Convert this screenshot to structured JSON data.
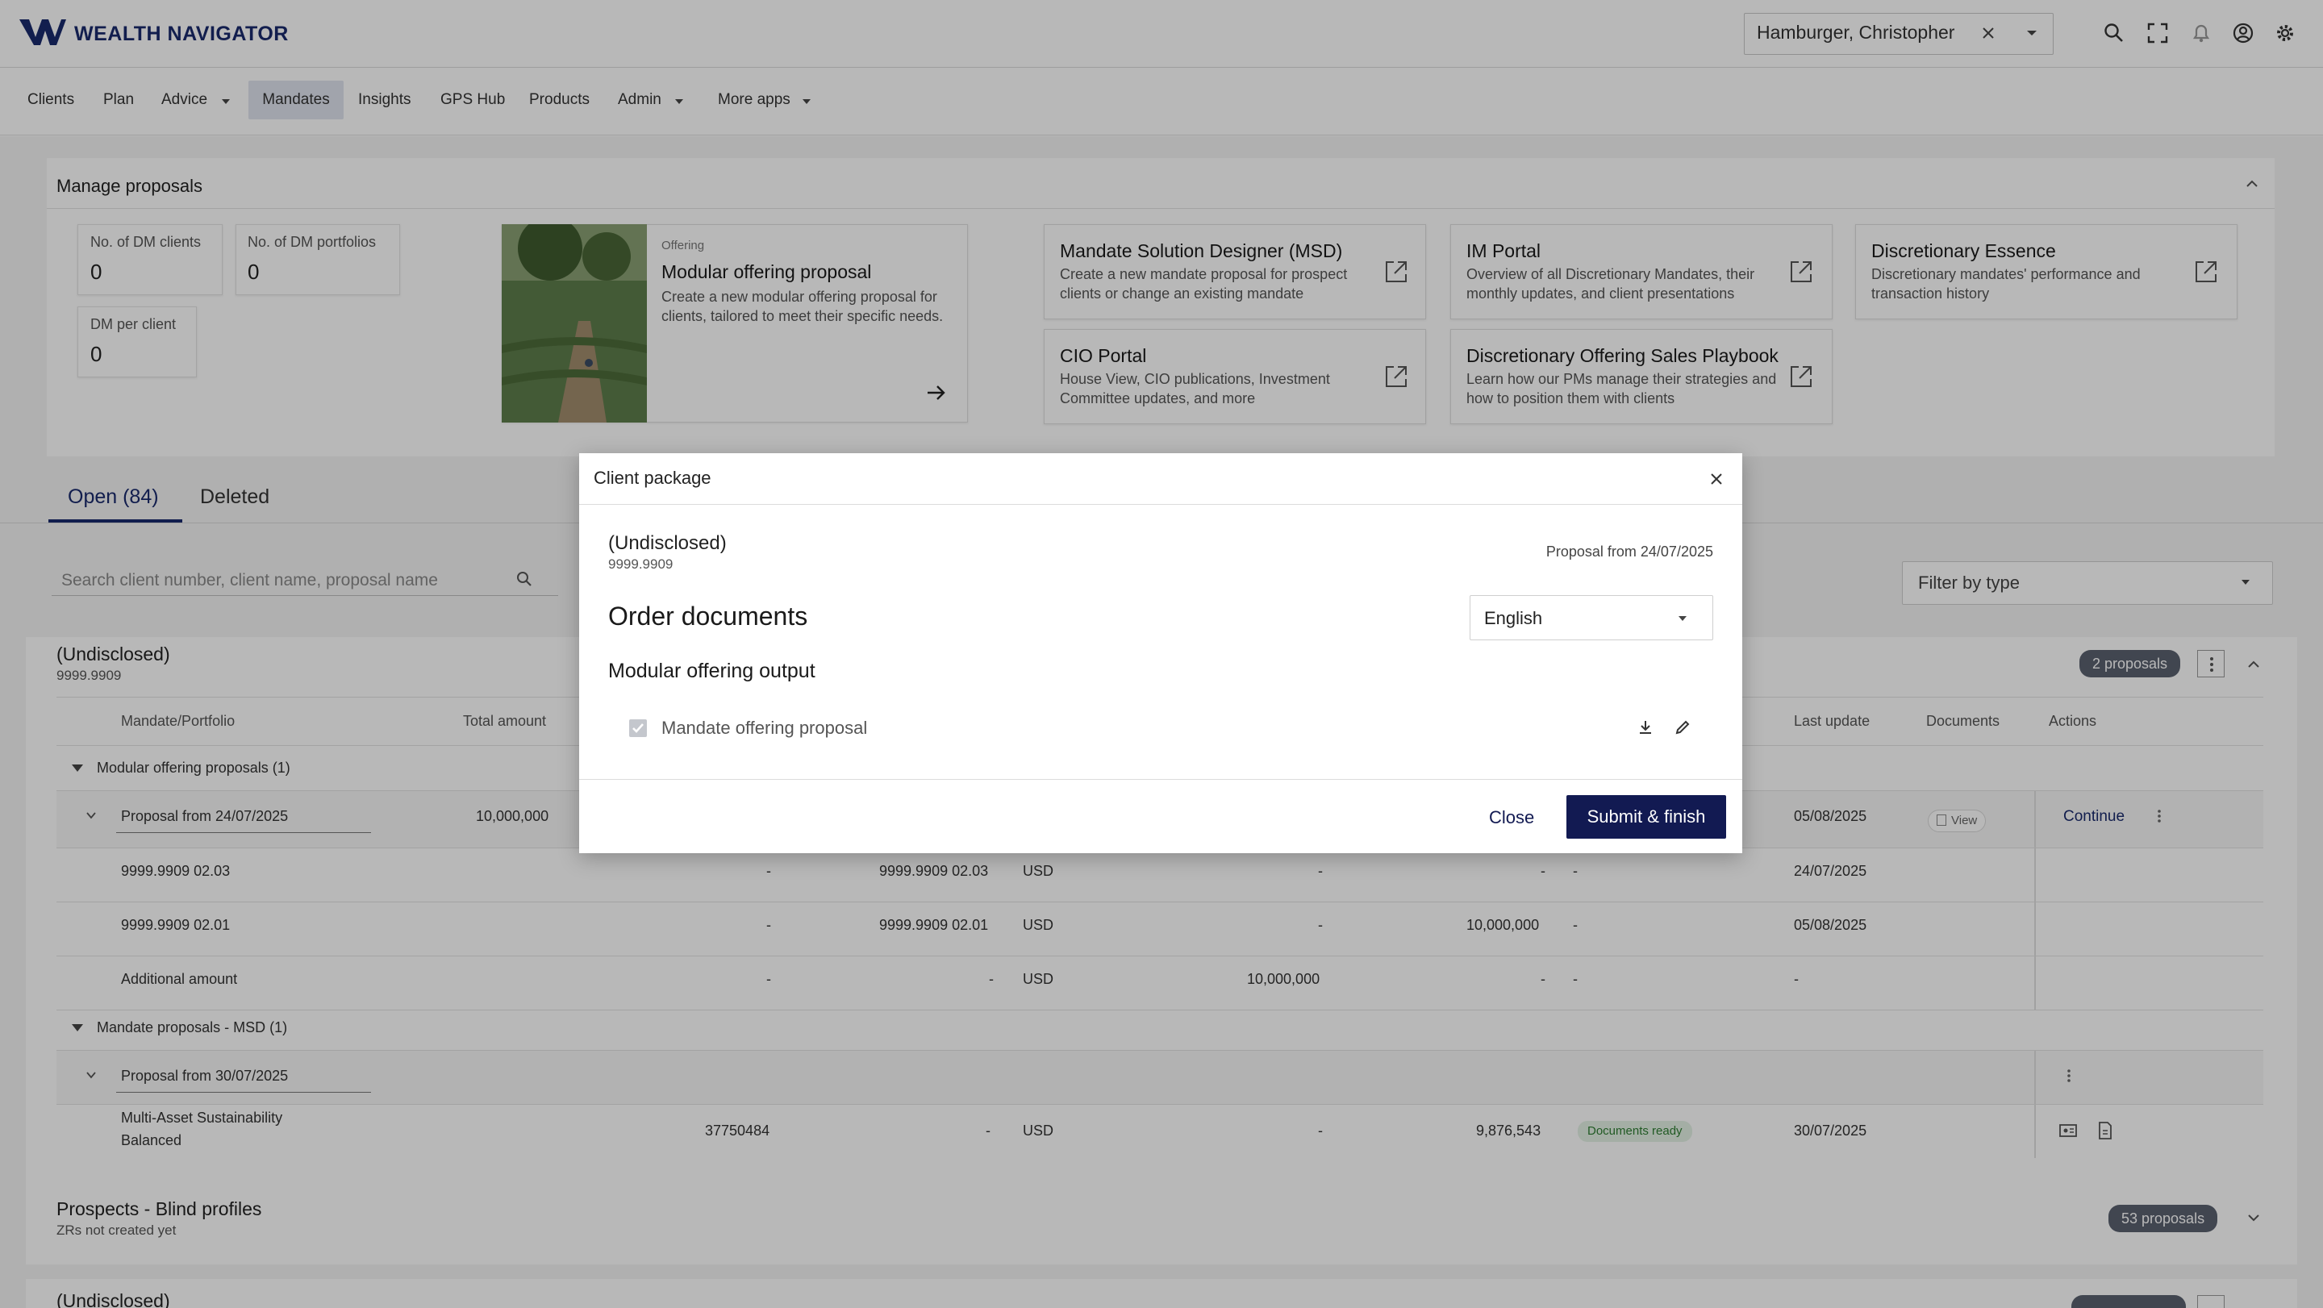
{
  "app": {
    "brand": "WEALTH NAVIGATOR"
  },
  "header": {
    "client_name": "Hamburger, Christopher",
    "icons": [
      "search-icon",
      "fullscreen-icon",
      "bell-icon",
      "user-icon",
      "gear-icon"
    ]
  },
  "nav": {
    "items": [
      {
        "label": "Clients"
      },
      {
        "label": "Plan"
      },
      {
        "label": "Advice"
      },
      {
        "label": "Mandates"
      },
      {
        "label": "Insights"
      },
      {
        "label": "GPS Hub"
      },
      {
        "label": "Products"
      },
      {
        "label": "Admin"
      },
      {
        "label": "More apps"
      }
    ],
    "active": "Mandates"
  },
  "manage": {
    "title": "Manage proposals",
    "kpis": [
      {
        "label": "No. of DM clients",
        "value": "0"
      },
      {
        "label": "No. of DM portfolios",
        "value": "0"
      },
      {
        "label": "DM per client",
        "value": "0"
      }
    ],
    "offering": {
      "eyebrow": "Offering",
      "title": "Modular offering proposal",
      "desc": "Create a new modular offering proposal for clients, tailored to meet their specific needs."
    },
    "tiles": [
      {
        "title": "Mandate Solution Designer (MSD)",
        "desc": "Create a new mandate proposal for prospect clients or change an existing mandate"
      },
      {
        "title": "IM Portal",
        "desc": "Overview of all Discretionary Mandates, their monthly updates, and client presentations"
      },
      {
        "title": "Discretionary Essence",
        "desc": "Discretionary mandates' performance and transaction history"
      },
      {
        "title": "CIO Portal",
        "desc": "House View, CIO publications, Investment Committee updates, and more"
      },
      {
        "title": "Discretionary Offering Sales Playbook",
        "desc": "Learn how our PMs manage their strategies and how to position them with clients"
      }
    ]
  },
  "tabs": {
    "open": "Open (84)",
    "deleted": "Deleted"
  },
  "filters": {
    "search_placeholder": "Search client number, client name, proposal name",
    "filter_type": "Filter by type"
  },
  "group1": {
    "name": "(Undisclosed)",
    "number": "9999.9909",
    "count": "2 proposals",
    "headers": {
      "mandate": "Mandate/Portfolio",
      "total": "Total amount",
      "last_update": "Last update",
      "documents": "Documents",
      "actions": "Actions"
    },
    "sub1": "Modular offering proposals (1)",
    "proposal1": {
      "name": "Proposal from 24/07/2025",
      "total": "10,000,000",
      "last_update": "05/08/2025",
      "doc": "View",
      "action": "Continue"
    },
    "rows": [
      {
        "name": "9999.9909 02.03",
        "c1": "-",
        "c2": "9999.9909 02.03",
        "cur": "USD",
        "c3": "-",
        "c4": "-",
        "c5": "-",
        "last": "24/07/2025"
      },
      {
        "name": "9999.9909 02.01",
        "c1": "-",
        "c2": "9999.9909 02.01",
        "cur": "USD",
        "c3": "-",
        "c4": "10,000,000",
        "c5": "-",
        "last": "05/08/2025"
      },
      {
        "name": "Additional amount",
        "c1": "-",
        "c2": "-",
        "cur": "USD",
        "c3": "10,000,000",
        "c4": "-",
        "c5": "-",
        "last": "-"
      }
    ],
    "sub2": "Mandate proposals - MSD (1)",
    "proposal2": {
      "name": "Proposal from 30/07/2025"
    },
    "msd_row": {
      "name1": "Multi-Asset Sustainability",
      "name2": "Balanced",
      "c1": "37750484",
      "c2": "-",
      "cur": "USD",
      "c3": "-",
      "c4": "9,876,543",
      "status": "Documents ready",
      "last": "30/07/2025"
    }
  },
  "group2": {
    "name": "Prospects - Blind profiles",
    "sub": "ZRs not created yet",
    "count": "53 proposals"
  },
  "group3": {
    "name": "(Undisclosed)"
  },
  "modal": {
    "title": "Client package",
    "client_name": "(Undisclosed)",
    "client_number": "9999.9909",
    "proposal_date": "Proposal from 24/07/2025",
    "section": "Order documents",
    "language": "English",
    "subsection": "Modular offering output",
    "doc_label": "Mandate offering proposal",
    "close_label": "Close",
    "submit_label": "Submit & finish"
  }
}
